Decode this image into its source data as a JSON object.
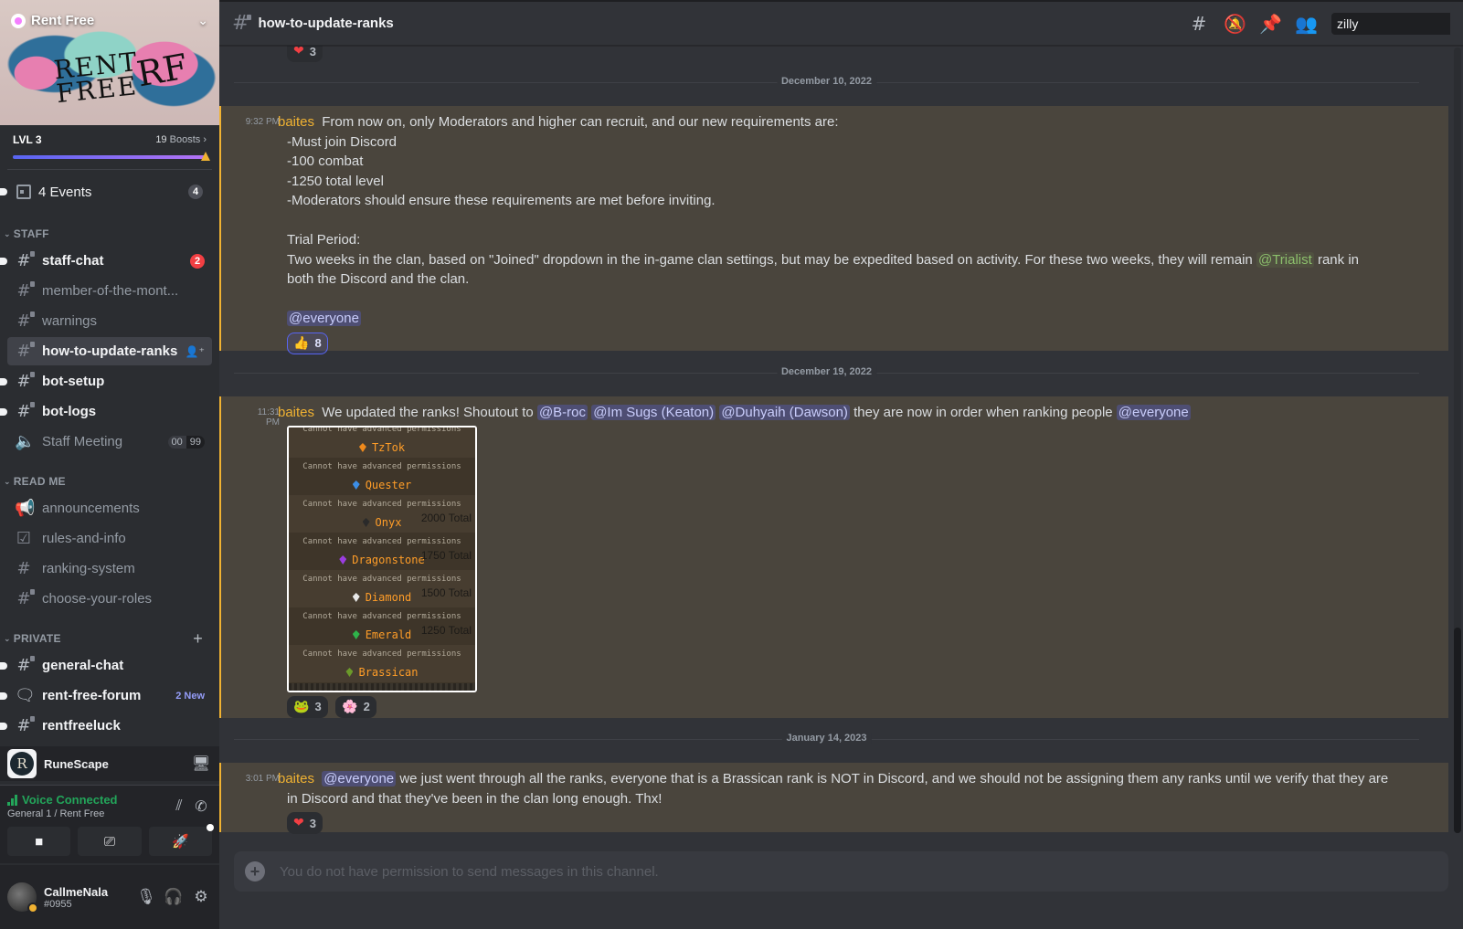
{
  "server": {
    "name": "Rent Free",
    "banner_text": "RENT FREE",
    "banner_text2": "RF",
    "level": "LVL 3",
    "boosts_count": "19",
    "boosts_label": "Boosts",
    "boost_progress_percent": 100
  },
  "events": {
    "label": "4 Events",
    "count": "4"
  },
  "categories": [
    {
      "name": "STAFF",
      "channels": [
        {
          "name": "staff-chat",
          "icon": "locked-text-channel-icon",
          "unread": true,
          "mentions": "2"
        },
        {
          "name": "member-of-the-mont...",
          "icon": "locked-text-channel-icon",
          "unread": false
        },
        {
          "name": "warnings",
          "icon": "locked-text-channel-icon",
          "unread": false
        },
        {
          "name": "how-to-update-ranks",
          "icon": "locked-text-channel-icon",
          "active": true
        },
        {
          "name": "bot-setup",
          "icon": "locked-text-channel-icon",
          "unread": true
        },
        {
          "name": "bot-logs",
          "icon": "locked-text-channel-icon",
          "unread": true
        },
        {
          "name": "Staff Meeting",
          "icon": "locked-voice-channel-icon",
          "voice_users": "00",
          "voice_limit": "99"
        }
      ]
    },
    {
      "name": "READ ME",
      "channels": [
        {
          "name": "announcements",
          "icon": "announcement-channel-icon"
        },
        {
          "name": "rules-and-info",
          "icon": "rules-channel-icon"
        },
        {
          "name": "ranking-system",
          "icon": "text-channel-icon"
        },
        {
          "name": "choose-your-roles",
          "icon": "locked-text-channel-icon"
        }
      ]
    },
    {
      "name": "PRIVATE",
      "channels": [
        {
          "name": "general-chat",
          "icon": "locked-text-channel-icon",
          "unread": true
        },
        {
          "name": "rent-free-forum",
          "icon": "forum-channel-icon",
          "unread": true,
          "badge": "2 New"
        },
        {
          "name": "rentfreeluck",
          "icon": "locked-text-channel-icon",
          "unread": true
        }
      ]
    }
  ],
  "activity": {
    "game": "RuneScape",
    "logo_letter": "R"
  },
  "voice": {
    "status": "Voice Connected",
    "location": "General 1 / Rent Free"
  },
  "user": {
    "name": "CallmeNala",
    "tag": "#0955",
    "status": "idle"
  },
  "header": {
    "channel": "how-to-update-ranks",
    "search_value": "zilly"
  },
  "messages": {
    "prev_reaction": {
      "emoji": "heart",
      "glyph": "❤",
      "count": "3"
    },
    "dividers": [
      "December 10, 2022",
      "December 19, 2022",
      "January 14, 2023"
    ],
    "m1": {
      "time": "9:32 PM",
      "author": "baites",
      "lines": [
        "From now on, only Moderators and higher can recruit, and our new requirements are:",
        "-Must join Discord",
        "-100 combat",
        "-1250 total level",
        "-Moderators should ensure these requirements are met before inviting.",
        "",
        "Trial Period:",
        "Two weeks in the clan, based on \"Joined\" dropdown in the in-game clan settings, but may be expedited based on activity. For these two weeks, they will remain",
        "rank in",
        "both the Discord and the clan."
      ],
      "role_mention": "@Trialist",
      "everyone": "@everyone",
      "reaction": {
        "emoji": "thumbs-up",
        "glyph": "👍",
        "count": "8"
      }
    },
    "m2": {
      "time": "11:31 PM",
      "author": "baites",
      "text_before": "We updated the ranks! Shoutout to",
      "mentions": [
        "@B-roc",
        "@Im Sugs (Keaton)",
        "@Duhyaih (Dawson)"
      ],
      "text_after": "they are now in order when ranking people",
      "everyone": "@everyone",
      "image": {
        "permission_text": "Cannot have advanced permissions",
        "ranks": [
          {
            "name": "TzTok",
            "gem": "#f08a1c",
            "total": ""
          },
          {
            "name": "Quester",
            "gem": "#3c8ee6",
            "total": ""
          },
          {
            "name": "Onyx",
            "gem": "#2a2a2a",
            "total": "2000 Total"
          },
          {
            "name": "Dragonstone",
            "gem": "#9b3de0",
            "total": "1750 Total"
          },
          {
            "name": "Diamond",
            "gem": "#e8e8e8",
            "total": "1500 Total"
          },
          {
            "name": "Emerald",
            "gem": "#2fb34a",
            "total": "1250 Total"
          },
          {
            "name": "Brassican",
            "gem": "#6b9a2a",
            "total": ""
          }
        ]
      },
      "reactions": [
        {
          "emoji": "pepe-heart",
          "glyph": "🐸",
          "count": "3"
        },
        {
          "emoji": "pink-anime",
          "glyph": "🌸",
          "count": "2"
        }
      ]
    },
    "m3": {
      "time": "3:01 PM",
      "author": "baites",
      "everyone": "@everyone",
      "line1": "we just went through all the ranks, everyone that is a Brassican rank is NOT in Discord, and we should not be assigning them any ranks until we verify that they are",
      "line2": "in Discord and that they've been in the clan long enough. Thx!",
      "reaction": {
        "emoji": "heart",
        "glyph": "❤",
        "count": "3"
      }
    }
  },
  "composer": {
    "placeholder": "You do not have permission to send messages in this channel."
  },
  "colors": {
    "accent": "#5865f2",
    "author": "#f0b232",
    "highlight_bg": "#4a453d",
    "mention_red": "#f23f43",
    "voice_green": "#23a55a"
  }
}
